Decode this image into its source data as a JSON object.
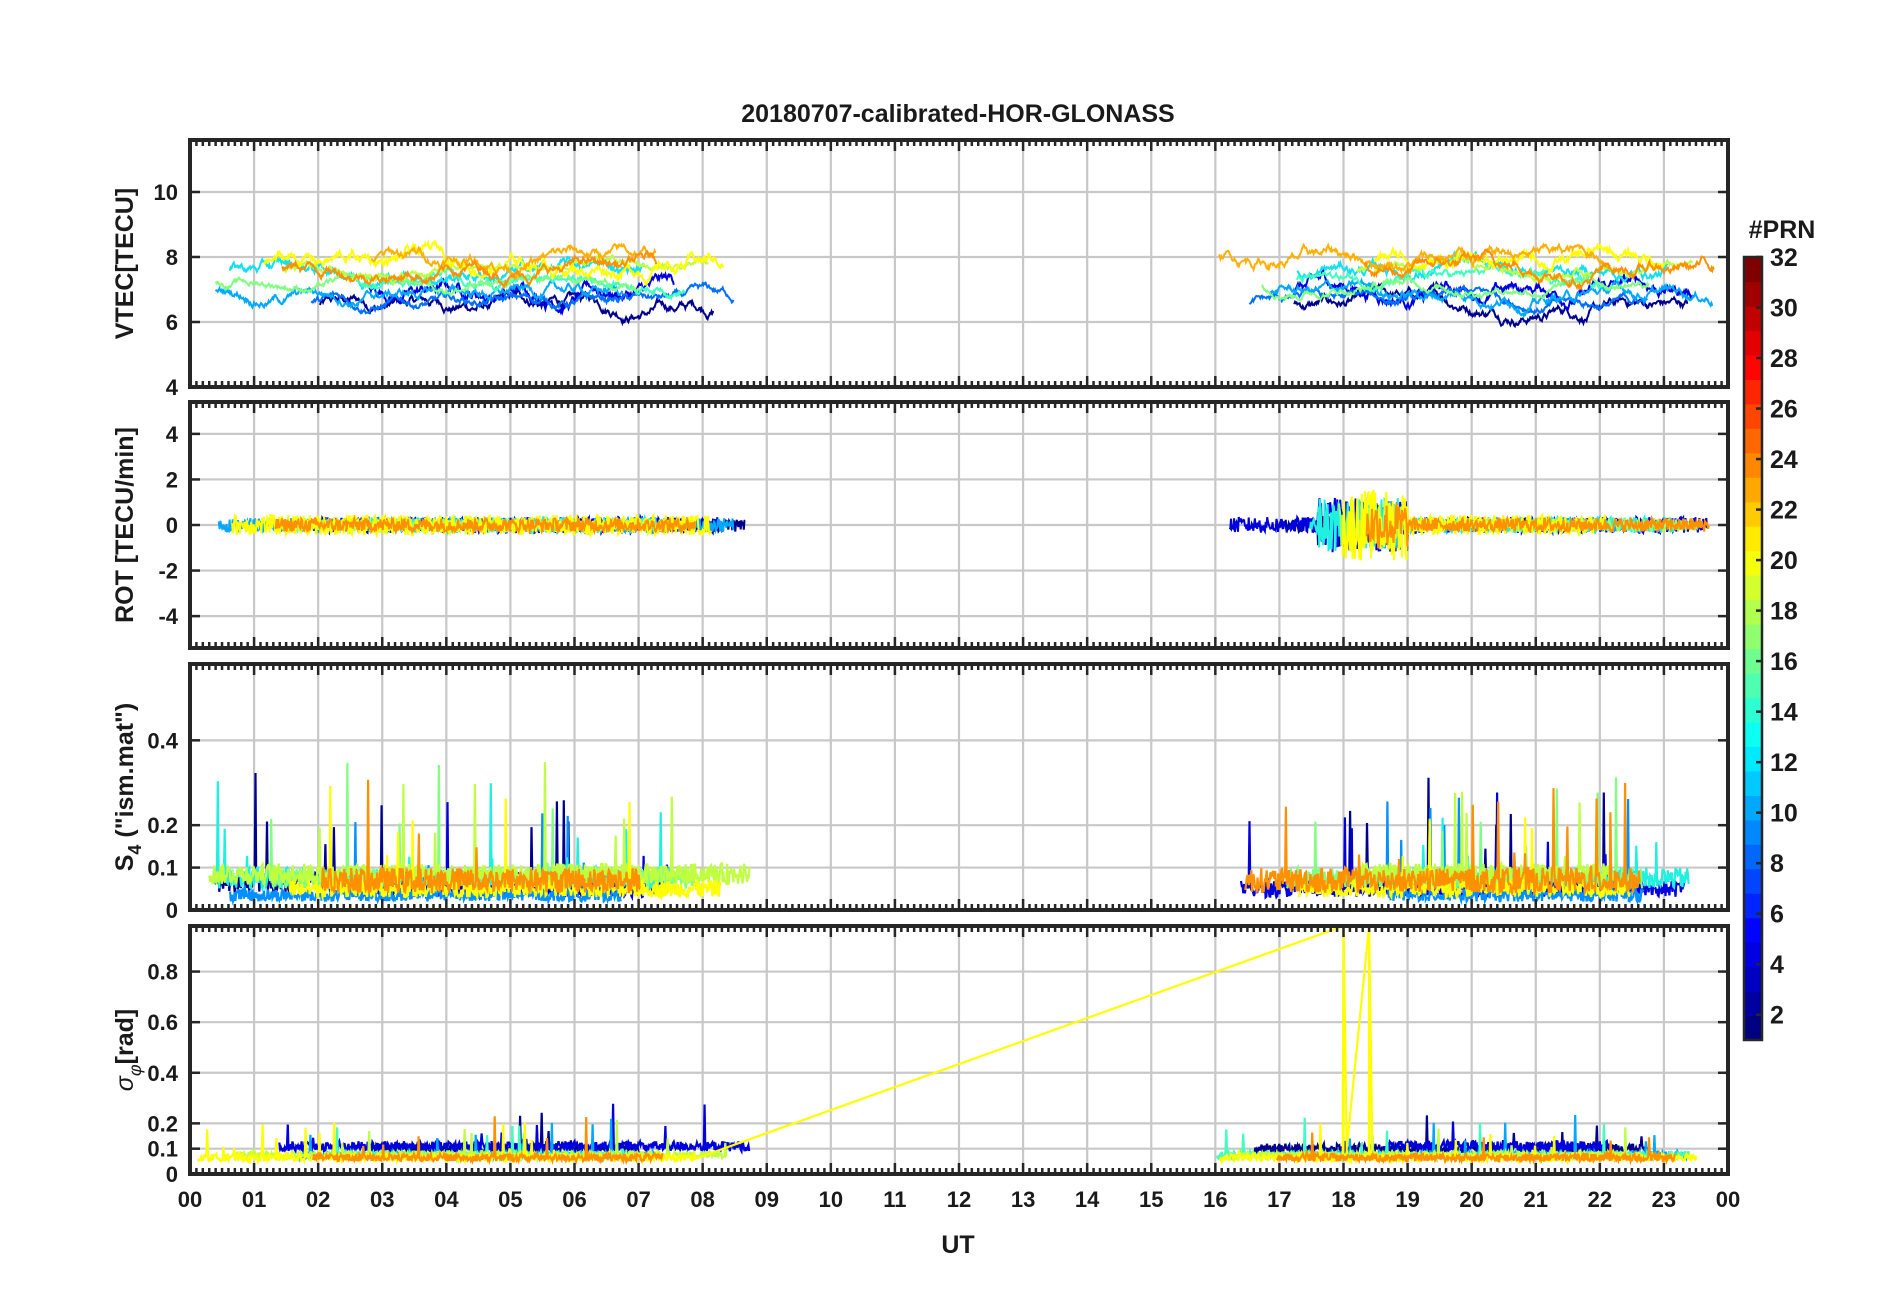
{
  "chart_data": {
    "type": "line",
    "title": "20180707-calibrated-HOR-GLONASS",
    "xlabel": "UT",
    "x_range_hours": [
      0,
      24
    ],
    "x_tick_labels": [
      "00",
      "01",
      "02",
      "03",
      "04",
      "05",
      "06",
      "07",
      "08",
      "09",
      "10",
      "11",
      "12",
      "13",
      "14",
      "15",
      "16",
      "17",
      "18",
      "19",
      "20",
      "21",
      "22",
      "23",
      "00"
    ],
    "data_gap_hours": [
      8.85,
      16.0
    ],
    "grid": true,
    "panels": [
      {
        "id": "vtec",
        "ylabel": "VTEC[TECU]",
        "ylim": [
          4,
          11.6
        ],
        "yticks": [
          4,
          6,
          8,
          10
        ],
        "segments": [
          [
            0,
            8.85
          ],
          [
            16.0,
            24
          ]
        ],
        "series": [
          {
            "prn": 1,
            "color": "#00008f",
            "base": 6.5,
            "noise": 0.5
          },
          {
            "prn": 3,
            "color": "#0000df",
            "base": 7.0,
            "noise": 0.6
          },
          {
            "prn": 8,
            "color": "#0070ff",
            "base": 6.6,
            "noise": 0.4
          },
          {
            "prn": 10,
            "color": "#00a8ff",
            "base": 6.9,
            "noise": 0.45
          },
          {
            "prn": 12,
            "color": "#10e0f0",
            "base": 7.6,
            "noise": 0.5
          },
          {
            "prn": 14,
            "color": "#40ffbf",
            "base": 7.3,
            "noise": 0.4
          },
          {
            "prn": 16,
            "color": "#80ff80",
            "base": 7.2,
            "noise": 0.35
          },
          {
            "prn": 18,
            "color": "#bfff40",
            "base": 7.6,
            "noise": 0.35
          },
          {
            "prn": 20,
            "color": "#ffff00",
            "base": 7.9,
            "noise": 0.6
          },
          {
            "prn": 22,
            "color": "#ffb000",
            "base": 8.0,
            "noise": 0.5
          },
          {
            "prn": 23,
            "color": "#ff9000",
            "base": 7.7,
            "noise": 0.5
          }
        ]
      },
      {
        "id": "rot",
        "ylabel": "ROT [TECU/min]",
        "ylim": [
          -5.4,
          5.4
        ],
        "yticks": [
          -4,
          -2,
          0,
          2,
          4
        ],
        "segments": [
          [
            0,
            8.85
          ],
          [
            16.0,
            24
          ]
        ],
        "series": [
          {
            "prn": 1,
            "color": "#00008f",
            "base": 0,
            "noise": 0.3
          },
          {
            "prn": 3,
            "color": "#0000df",
            "base": 0,
            "noise": 0.35
          },
          {
            "prn": 10,
            "color": "#00a8ff",
            "base": 0,
            "noise": 0.3
          },
          {
            "prn": 13,
            "color": "#20f0e0",
            "base": 0,
            "noise": 0.35
          },
          {
            "prn": 17,
            "color": "#a0ff60",
            "base": 0,
            "noise": 0.3
          },
          {
            "prn": 20,
            "color": "#ffff00",
            "base": 0,
            "noise": 0.45
          },
          {
            "prn": 23,
            "color": "#ff9000",
            "base": 0,
            "noise": 0.3
          }
        ]
      },
      {
        "id": "s4",
        "ylabel": "S4 (\"ism.mat\")",
        "ylabel_main": "S",
        "ylabel_sub": "4",
        "ylabel_tail": " (\"ism.mat\")",
        "ylim": [
          0,
          0.58
        ],
        "yticks": [
          0,
          0.1,
          0.2,
          0.4
        ],
        "segments": [
          [
            0,
            8.85
          ],
          [
            16.0,
            24
          ]
        ],
        "series": [
          {
            "prn": 1,
            "color": "#00008f",
            "base": 0.04,
            "noise": 0.05
          },
          {
            "prn": 3,
            "color": "#0000df",
            "base": 0.03,
            "noise": 0.04
          },
          {
            "prn": 9,
            "color": "#0090ff",
            "base": 0.02,
            "noise": 0.03
          },
          {
            "prn": 13,
            "color": "#20f0e0",
            "base": 0.05,
            "noise": 0.05
          },
          {
            "prn": 16,
            "color": "#80ff80",
            "base": 0.05,
            "noise": 0.05
          },
          {
            "prn": 18,
            "color": "#bfff40",
            "base": 0.06,
            "noise": 0.05
          },
          {
            "prn": 20,
            "color": "#ffff00",
            "base": 0.03,
            "noise": 0.04
          },
          {
            "prn": 23,
            "color": "#ff9000",
            "base": 0.04,
            "noise": 0.06
          }
        ]
      },
      {
        "id": "sigphi",
        "ylabel": "σφ[rad]",
        "ylabel_main": "σ",
        "ylabel_sub": "φ",
        "ylabel_tail": "[rad]",
        "ylim": [
          0,
          0.98
        ],
        "yticks": [
          0,
          0.1,
          0.2,
          0.4,
          0.6,
          0.8
        ],
        "segments": [
          [
            0,
            8.85
          ],
          [
            16.0,
            24
          ]
        ],
        "series": [
          {
            "prn": 1,
            "color": "#00008f",
            "base": 0.08,
            "noise": 0.04
          },
          {
            "prn": 3,
            "color": "#0000df",
            "base": 0.09,
            "noise": 0.04
          },
          {
            "prn": 10,
            "color": "#00a8ff",
            "base": 0.06,
            "noise": 0.03
          },
          {
            "prn": 14,
            "color": "#40ffbf",
            "base": 0.06,
            "noise": 0.03
          },
          {
            "prn": 18,
            "color": "#bfff40",
            "base": 0.06,
            "noise": 0.03
          },
          {
            "prn": 20,
            "color": "#ffff00",
            "base": 0.05,
            "noise": 0.03
          },
          {
            "prn": 23,
            "color": "#ff9000",
            "base": 0.05,
            "noise": 0.03
          }
        ]
      }
    ],
    "colorbar": {
      "label": "#PRN",
      "min": 1,
      "max": 32,
      "ticks": [
        2,
        4,
        6,
        8,
        10,
        12,
        14,
        16,
        18,
        20,
        22,
        24,
        26,
        28,
        30,
        32
      ],
      "colormap": "jet",
      "steps": 32
    }
  }
}
